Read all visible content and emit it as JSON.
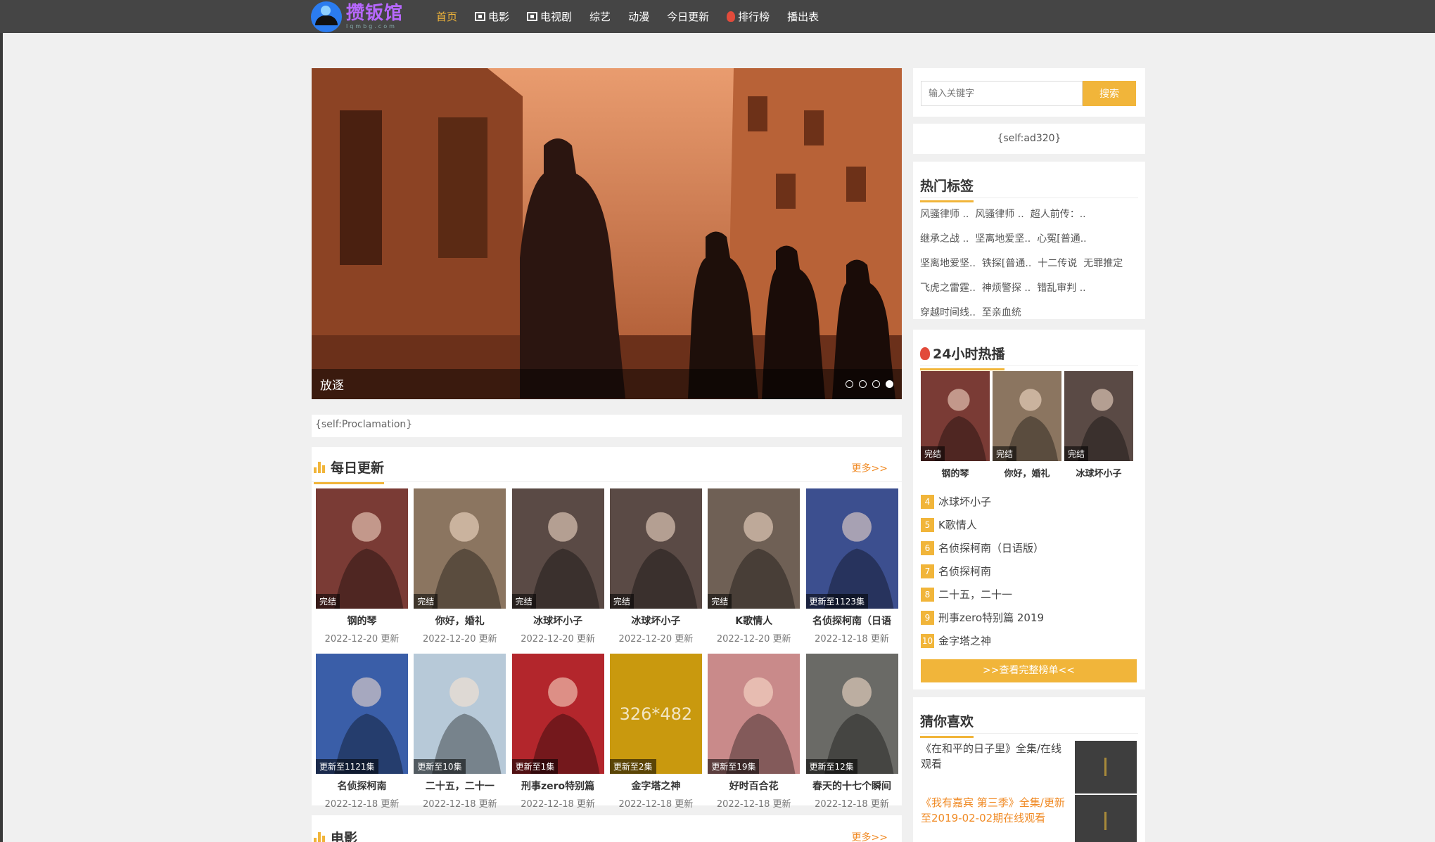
{
  "logo": {
    "name": "攒钣馆",
    "sub": "lqmbg.com"
  },
  "nav": [
    {
      "label": "首页",
      "icon": ""
    },
    {
      "label": "电影",
      "icon": "film-icon"
    },
    {
      "label": "电视剧",
      "icon": "film-icon"
    },
    {
      "label": "综艺",
      "icon": ""
    },
    {
      "label": "动漫",
      "icon": ""
    },
    {
      "label": "今日更新",
      "icon": ""
    },
    {
      "label": "排行榜",
      "icon": "fire-icon"
    },
    {
      "label": "播出表",
      "icon": ""
    }
  ],
  "banner": {
    "title": "放逐",
    "slides": 4,
    "active": 4
  },
  "proclamation": "{self:Proclamation}",
  "daily": {
    "title": "每日更新",
    "more": "更多>>",
    "items": [
      {
        "title": "钢的琴",
        "badge": "完结",
        "date": "2022-12-20 更新",
        "color": "#7a3b35"
      },
      {
        "title": "你好，婚礼",
        "badge": "完结",
        "date": "2022-12-20 更新",
        "color": "#8b7560"
      },
      {
        "title": "冰球坏小子",
        "badge": "完结",
        "date": "2022-12-20 更新",
        "color": "#5a4a45"
      },
      {
        "title": "冰球坏小子",
        "badge": "完结",
        "date": "2022-12-20 更新",
        "color": "#5a4a45"
      },
      {
        "title": "K歌情人",
        "badge": "完结",
        "date": "2022-12-20 更新",
        "color": "#6f6055"
      },
      {
        "title": "名侦探柯南（日语",
        "badge": "更新至1123集",
        "date": "2022-12-18 更新",
        "color": "#3c4f8f"
      },
      {
        "title": "名侦探柯南",
        "badge": "更新至1121集",
        "date": "2022-12-18 更新",
        "color": "#3a5ea8"
      },
      {
        "title": "二十五，二十一",
        "badge": "更新至10集",
        "date": "2022-12-18 更新",
        "color": "#b7c9d8"
      },
      {
        "title": "刑事zero特别篇",
        "badge": "更新至1集",
        "date": "2022-12-18 更新",
        "color": "#b3262c"
      },
      {
        "title": "金字塔之神",
        "badge": "更新至2集",
        "date": "2022-12-18 更新",
        "color": "#c9990e",
        "placeholder": "326*482"
      },
      {
        "title": "好时百合花",
        "badge": "更新至19集",
        "date": "2022-12-18 更新",
        "color": "#c98a8a"
      },
      {
        "title": "春天的十七个瞬间",
        "badge": "更新至12集",
        "date": "2022-12-18 更新",
        "color": "#6a6a66"
      }
    ]
  },
  "movies": {
    "title": "电影",
    "more": "更多>>"
  },
  "search": {
    "placeholder": "输入关键字",
    "button": "搜索"
  },
  "ad": "{self:ad320}",
  "tags": {
    "title": "热门标签",
    "items": [
      "风骚律师 ..",
      "风骚律师 ..",
      "超人前传：..",
      "继承之战 ..",
      "坚离地爱坚..",
      "心冤[普通..",
      "坚离地爱坚..",
      "铁探[普通..",
      "十二传说",
      "无罪推定",
      "飞虎之雷霆..",
      "神烦警探 ..",
      "错乱审判 ..",
      "穿越时间线..",
      "至亲血统"
    ]
  },
  "hot": {
    "title": "24小时热播",
    "thumbs": [
      {
        "title": "钢的琴",
        "badge": "完结",
        "color": "#7a3b35"
      },
      {
        "title": "你好，婚礼",
        "badge": "完结",
        "color": "#8b7560"
      },
      {
        "title": "冰球坏小子",
        "badge": "完结",
        "color": "#5a4a45"
      }
    ],
    "ranks": [
      {
        "num": "4",
        "title": "冰球坏小子"
      },
      {
        "num": "5",
        "title": "K歌情人"
      },
      {
        "num": "6",
        "title": "名侦探柯南（日语版）"
      },
      {
        "num": "7",
        "title": "名侦探柯南"
      },
      {
        "num": "8",
        "title": "二十五，二十一"
      },
      {
        "num": "9",
        "title": "刑事zero特别篇 2019"
      },
      {
        "num": "10",
        "title": "金字塔之神"
      }
    ],
    "button": ">>查看完整榜单<<"
  },
  "like": {
    "title": "猜你喜欢",
    "items": [
      {
        "text": "《在和平的日子里》全集/在线观看",
        "color": "#444"
      },
      {
        "text": "《我有嘉宾 第三季》全集/更新至2019-02-02期在线观看",
        "color": "#f08a24"
      }
    ]
  }
}
